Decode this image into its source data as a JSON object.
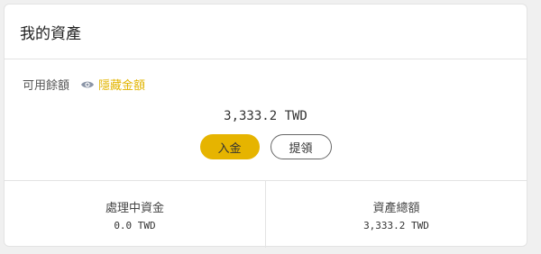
{
  "card": {
    "title": "我的資產",
    "available_label": "可用餘額",
    "hide_label": "隱藏金額",
    "balance": "3,333.2 TWD",
    "deposit_label": "入金",
    "withdraw_label": "提領"
  },
  "stats": [
    {
      "label": "處理中資金",
      "value": "0.0 TWD"
    },
    {
      "label": "資產總額",
      "value": "3,333.2 TWD"
    }
  ],
  "colors": {
    "accent": "#e6b400",
    "link": "#e2b400",
    "icon": "#8a94a6"
  }
}
